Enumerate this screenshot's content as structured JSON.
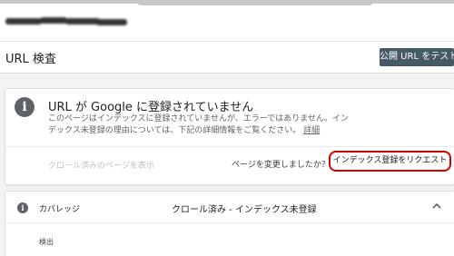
{
  "header": {
    "page_title": "URL 検査",
    "test_button_label": "公開 URL をテスト"
  },
  "status": {
    "heading": "URL が Google に登録されていません",
    "description": "このページはインデックスに登録されていませんが、エラーではありません。インデックス未登録の理由については、下記の詳細情報をご覧ください。",
    "detail_link": "詳細",
    "crawled_page_link": "クロール済みのページを表示",
    "changed_question": "ページを変更しましたか？",
    "request_indexing_label": "インデックス登録をリクエスト",
    "highlight_color": "#d40000"
  },
  "coverage": {
    "label": "カバレッジ",
    "value": "クロール済み - インデックス未登録",
    "sub_label": "検出"
  },
  "icons": {
    "info": "info-icon",
    "chevron": "chevron-up-icon"
  },
  "colors": {
    "button_bg": "#455a64",
    "page_bg": "#f1f3f4"
  }
}
